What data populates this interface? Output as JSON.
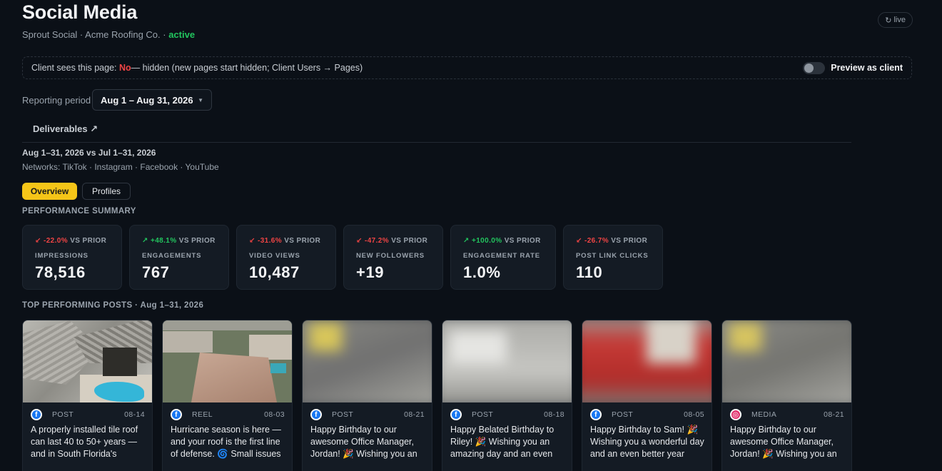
{
  "header": {
    "title": "Social Media",
    "subtitle_prefix": "Sprout Social · Acme Roofing Co. · ",
    "status": "active",
    "live_label": "live",
    "live_icon": "refresh-icon"
  },
  "visibility": {
    "prefix": "Client sees this page: ",
    "value": "No",
    "suffix": " — hidden (new pages start hidden; Client Users → Pages)",
    "preview_label": "Preview as client",
    "preview_on": false
  },
  "period": {
    "label": "Reporting period",
    "value": "Aug 1 – Aug 31, 2026"
  },
  "deliverables": {
    "label": "Deliverables ↗"
  },
  "comparison": "Aug 1–31, 2026 vs Jul 1–31, 2026",
  "networks": "Networks: TikTok · Instagram · Facebook · YouTube",
  "tabs": [
    {
      "label": "Overview",
      "active": true
    },
    {
      "label": "Profiles",
      "active": false
    }
  ],
  "summary_title": "PERFORMANCE SUMMARY",
  "kpis": [
    {
      "delta": "-22.0%",
      "trend": "down",
      "suffix": " VS PRIOR",
      "label": "IMPRESSIONS",
      "value": "78,516"
    },
    {
      "delta": "+48.1%",
      "trend": "up",
      "suffix": " VS PRIOR",
      "label": "ENGAGEMENTS",
      "value": "767"
    },
    {
      "delta": "-31.6%",
      "trend": "down",
      "suffix": " VS PRIOR",
      "label": "VIDEO VIEWS",
      "value": "10,487"
    },
    {
      "delta": "-47.2%",
      "trend": "down",
      "suffix": " VS PRIOR",
      "label": "NEW FOLLOWERS",
      "value": "+19"
    },
    {
      "delta": "+100.0%",
      "trend": "up",
      "suffix": " VS PRIOR",
      "label": "ENGAGEMENT RATE",
      "value": "1.0%"
    },
    {
      "delta": "-26.7%",
      "trend": "down",
      "suffix": " VS PRIOR",
      "label": "POST LINK CLICKS",
      "value": "110"
    }
  ],
  "top_title": "TOP PERFORMING POSTS · Aug 1–31, 2026",
  "posts": [
    {
      "network": "facebook-icon",
      "type": "POST",
      "date": "08-14",
      "caption": "A properly installed tile roof can last 40 to 50+ years — and in South Florida's"
    },
    {
      "network": "facebook-icon",
      "type": "REEL",
      "date": "08-03",
      "caption": "Hurricane season is here — and your roof is the first line of defense. 🌀 Small issues"
    },
    {
      "network": "facebook-icon",
      "type": "POST",
      "date": "08-21",
      "caption": "Happy Birthday to our awesome Office Manager, Jordan! 🎉 Wishing you an"
    },
    {
      "network": "facebook-icon",
      "type": "POST",
      "date": "08-18",
      "caption": "Happy Belated Birthday to Riley! 🎉 Wishing you an amazing day and an even"
    },
    {
      "network": "facebook-icon",
      "type": "POST",
      "date": "08-05",
      "caption": "Happy Birthday to Sam! 🎉 Wishing you a wonderful day and an even better year"
    },
    {
      "network": "instagram-icon",
      "type": "MEDIA",
      "date": "08-21",
      "caption": "Happy Birthday to our awesome Office Manager, Jordan! 🎉 Wishing you an"
    }
  ],
  "colors": {
    "accent": "#f5c518",
    "up": "#22c55e",
    "down": "#ef4444",
    "background": "#0b1017",
    "card": "#141b24"
  }
}
